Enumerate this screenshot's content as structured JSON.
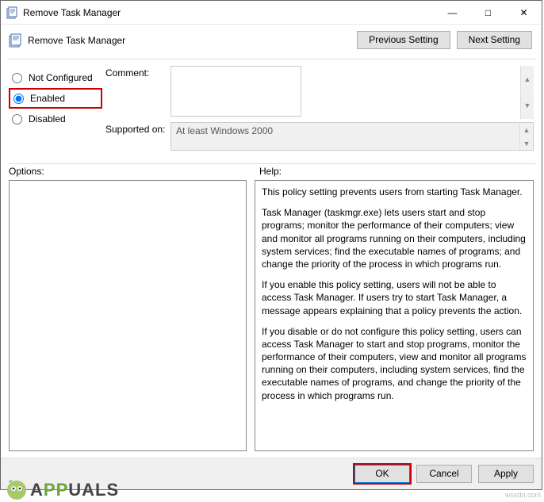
{
  "titlebar": {
    "title": "Remove Task Manager"
  },
  "header": {
    "title": "Remove Task Manager",
    "prev": "Previous Setting",
    "next": "Next Setting"
  },
  "radios": {
    "not_configured": "Not Configured",
    "enabled": "Enabled",
    "disabled": "Disabled"
  },
  "form": {
    "comment_label": "Comment:",
    "comment_value": "",
    "supported_label": "Supported on:",
    "supported_value": "At least Windows 2000"
  },
  "panels": {
    "options_label": "Options:",
    "help_label": "Help:"
  },
  "help": {
    "p1": "This policy setting prevents users from starting Task Manager.",
    "p2": "Task Manager (taskmgr.exe) lets users start and stop programs; monitor the performance of their computers; view and monitor all programs running on their computers, including system services; find the executable names of programs; and change the priority of the process in which programs run.",
    "p3": "If you enable this policy setting, users will not be able to access Task Manager. If users try to start Task Manager, a message appears explaining that a policy prevents the action.",
    "p4": "If you disable or do not configure this policy setting, users can access Task Manager to  start and stop programs, monitor the performance of their computers, view and monitor all programs running on their computers, including system services, find the executable names of programs, and change the priority of the process in which programs run."
  },
  "footer": {
    "ok": "OK",
    "cancel": "Cancel",
    "apply": "Apply"
  },
  "watermark": {
    "brand_a": "A",
    "brand_pp": "PP",
    "brand_uals": "UALS",
    "corner": "wsxdn.com"
  }
}
